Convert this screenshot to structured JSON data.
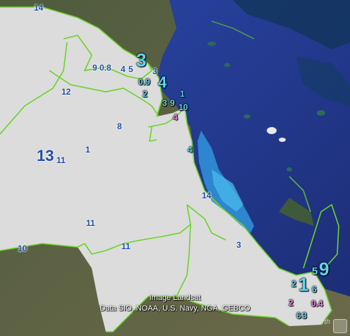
{
  "map": {
    "attribution_line1": "Image Landsat",
    "attribution_line2": "Data SIO, NOAA, U.S. Navy, NGA, GEBCO",
    "google_label": "Google earth",
    "colors": {
      "land_fill": "#dedede",
      "ocean": "#22378c",
      "shallow": "#2f8fd6",
      "border": "#6ad427",
      "label_dark": "#1f4fa0",
      "label_light": "#5fd3f0",
      "label_pink": "#e58ce0"
    },
    "labels": [
      {
        "text": "14"
      },
      {
        "text": "12"
      },
      {
        "text": "9"
      },
      {
        "text": "0.8"
      },
      {
        "text": "4"
      },
      {
        "text": "5"
      },
      {
        "text": "3"
      },
      {
        "text": "3"
      },
      {
        "text": "0.9"
      },
      {
        "text": "4"
      },
      {
        "text": "2"
      },
      {
        "text": "1"
      },
      {
        "text": "3"
      },
      {
        "text": "9"
      },
      {
        "text": "10"
      },
      {
        "text": "4"
      },
      {
        "text": "8"
      },
      {
        "text": "1"
      },
      {
        "text": "13"
      },
      {
        "text": "11"
      },
      {
        "text": "4"
      },
      {
        "text": "14"
      },
      {
        "text": "11"
      },
      {
        "text": "11"
      },
      {
        "text": "10"
      },
      {
        "text": "3"
      },
      {
        "text": "5"
      },
      {
        "text": "9"
      },
      {
        "text": "2"
      },
      {
        "text": "1"
      },
      {
        "text": "6"
      },
      {
        "text": "2"
      },
      {
        "text": "0.4"
      },
      {
        "text": "6"
      },
      {
        "text": "3"
      }
    ]
  }
}
